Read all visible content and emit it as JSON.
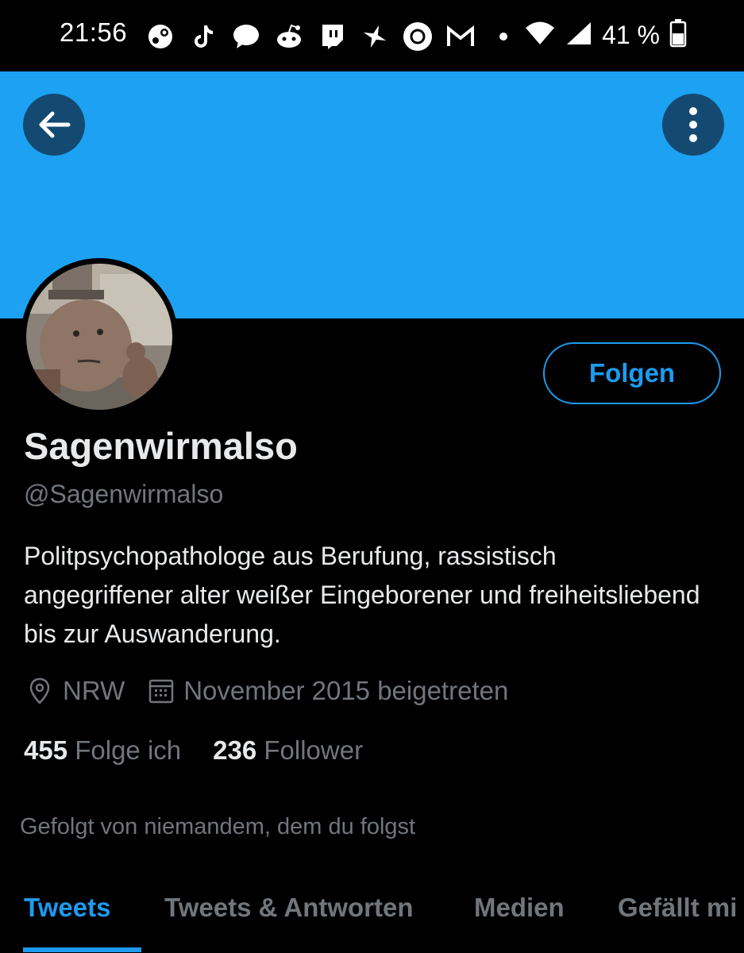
{
  "status_bar": {
    "time": "21:56",
    "notification_icons": [
      "steam-icon",
      "tiktok-icon",
      "messages-icon",
      "reddit-icon",
      "twitch-icon",
      "sparkle-icon",
      "circle-app-icon",
      "mail-icon",
      "dot-icon"
    ],
    "battery_percent": "41 %"
  },
  "colors": {
    "banner": "#1da1f2",
    "accent": "#1d9bf0",
    "back_button_bg": "#144a72"
  },
  "profile": {
    "display_name": "Sagenwirmalso",
    "handle": "@Sagenwirmalso",
    "bio": "Politpsychopathologe aus Berufung, rassistisch angegriffener alter weißer Eingeborener und freiheitsliebend bis zur Auswanderung.",
    "location": "NRW",
    "joined": "November 2015 beigetreten",
    "following_count": "455",
    "following_label": "Folge ich",
    "followers_count": "236",
    "followers_label": "Follower",
    "followed_by": "Gefolgt von niemandem, dem du folgst"
  },
  "actions": {
    "follow_label": "Folgen"
  },
  "tabs": [
    {
      "label": "Tweets",
      "active": true
    },
    {
      "label": "Tweets & Antworten",
      "active": false
    },
    {
      "label": "Medien",
      "active": false
    },
    {
      "label": "Gefällt mi",
      "active": false
    }
  ]
}
